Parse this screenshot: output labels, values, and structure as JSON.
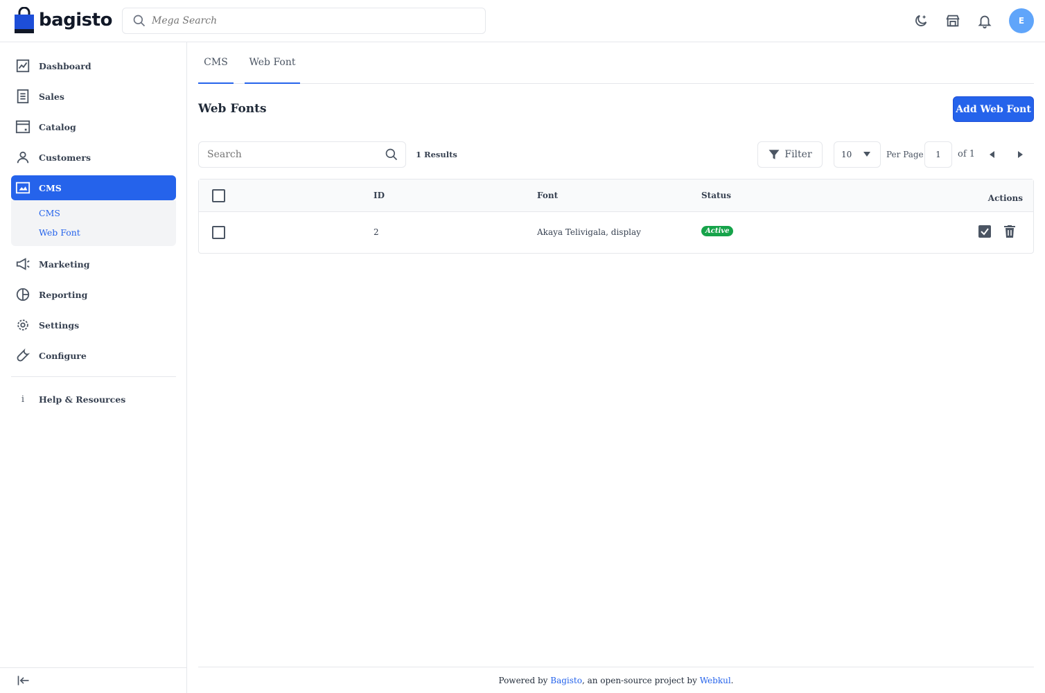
{
  "brand": {
    "name": "bagisto"
  },
  "header": {
    "search_placeholder": "Mega Search",
    "user_initial": "E"
  },
  "sidebar": {
    "items": [
      {
        "label": "Dashboard",
        "icon": "dashboard-icon"
      },
      {
        "label": "Sales",
        "icon": "sales-icon"
      },
      {
        "label": "Catalog",
        "icon": "catalog-icon"
      },
      {
        "label": "Customers",
        "icon": "customers-icon"
      },
      {
        "label": "CMS",
        "icon": "cms-icon",
        "active": true
      },
      {
        "label": "Marketing",
        "icon": "megaphone-icon"
      },
      {
        "label": "Reporting",
        "icon": "pie-chart-icon"
      },
      {
        "label": "Settings",
        "icon": "gear-icon"
      },
      {
        "label": "Configure",
        "icon": "wrench-icon"
      }
    ],
    "cms_submenu": [
      {
        "label": "CMS"
      },
      {
        "label": "Web Font"
      }
    ],
    "help_label": "Help & Resources"
  },
  "tabs": [
    {
      "label": "CMS"
    },
    {
      "label": "Web Font",
      "active": true
    }
  ],
  "page": {
    "title": "Web Fonts",
    "add_button": "Add Web Font"
  },
  "toolbar": {
    "search_placeholder": "Search",
    "results": "1 Results",
    "filter_label": "Filter",
    "per_page_value": "10",
    "per_page_label": "Per Page",
    "current_page": "1",
    "of_pages": "of 1"
  },
  "table": {
    "headers": {
      "id": "ID",
      "font": "Font",
      "status": "Status",
      "actions": "Actions"
    },
    "rows": [
      {
        "id": "2",
        "font": "Akaya Telivigala, display",
        "status": "Active"
      }
    ]
  },
  "footer": {
    "prefix": "Powered by ",
    "link1": "Bagisto",
    "middle": ", an open-source project by ",
    "link2": "Webkul",
    "suffix": "."
  },
  "colors": {
    "accent": "#2563eb",
    "status_active": "#16a34a",
    "avatar": "#60a5fa"
  }
}
